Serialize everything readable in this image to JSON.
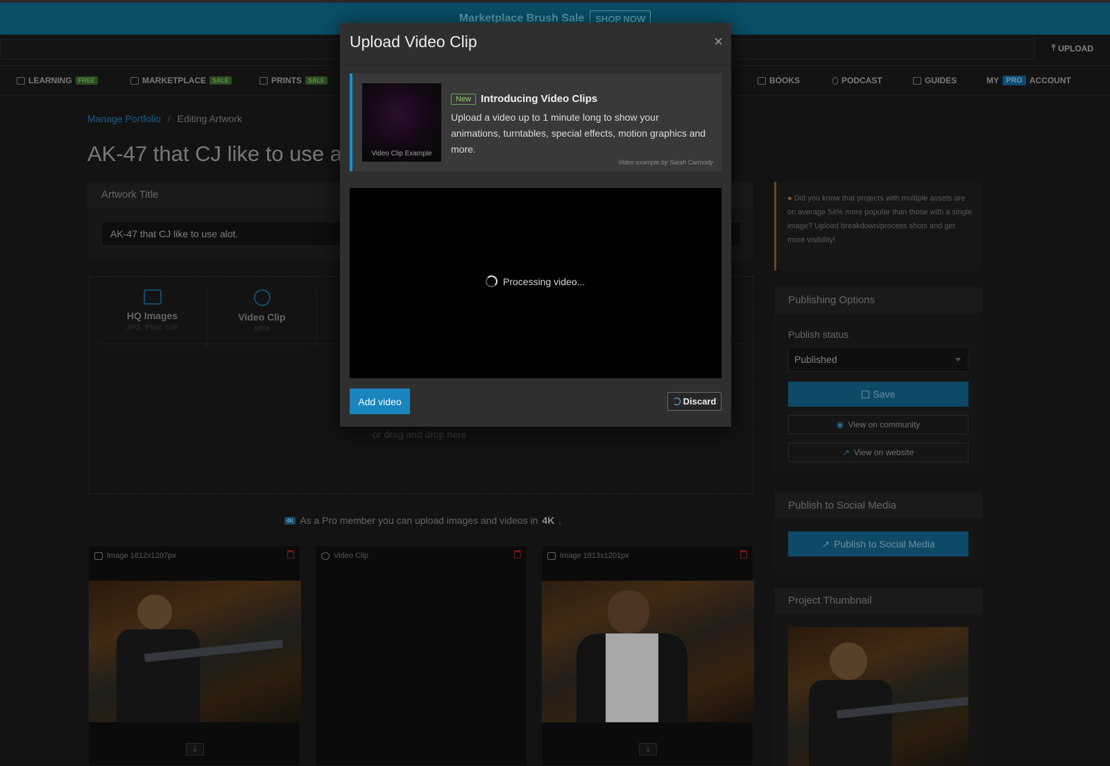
{
  "banner": {
    "text": "Marketplace Brush Sale",
    "cta": "SHOP NOW"
  },
  "header": {
    "upload_label": "UPLOAD"
  },
  "nav": {
    "learning": "LEARNING",
    "learning_tag": "FREE",
    "marketplace": "MARKETPLACE",
    "marketplace_tag": "SALE",
    "prints": "PRINTS",
    "prints_tag": "SALE",
    "books": "BOOKS",
    "podcast": "PODCAST",
    "guides": "GUIDES",
    "account_my": "MY",
    "account_pro": "PRO",
    "account_label": "ACCOUNT"
  },
  "breadcrumb": {
    "parent": "Manage Portfolio",
    "separator": "/",
    "current": "Editing Artwork"
  },
  "page": {
    "title": "AK-47 that CJ like to use alot."
  },
  "artwork_title": {
    "heading": "Artwork Title",
    "value": "AK-47 that CJ like to use alot."
  },
  "upload_types": [
    {
      "label": "HQ Images",
      "sub": "JPG, PNG, GIF"
    },
    {
      "label": "Video Clip",
      "sub": "MP4"
    }
  ],
  "dropzone": {
    "drag_text": "or drag and drop here"
  },
  "pro_note": {
    "badge": "4K",
    "text": "As a Pro member you can upload images and videos in",
    "emph": "4K",
    "end": "."
  },
  "assets": [
    {
      "label": "Image 1812x1207px"
    },
    {
      "label": "Video Clip"
    },
    {
      "label": "Image 1813x1201px"
    }
  ],
  "sidebar": {
    "tip": "Did you know that projects with multiple assets are on average 54% more popular than those with a single image? Upload breakdown/process shots and get more visibility!",
    "publishing_heading": "Publishing Options",
    "publish_status_label": "Publish status",
    "publish_status_value": "Published",
    "save_label": "Save",
    "view_community": "View on community",
    "view_website": "View on website",
    "social_heading": "Publish to Social Media",
    "social_button": "Publish to Social Media",
    "thumbnail_heading": "Project Thumbnail"
  },
  "modal": {
    "title": "Upload Video Clip",
    "close": "×",
    "thumb_caption": "Video Clip Example",
    "new_badge": "New",
    "intro_title": "Introducing Video Clips",
    "intro_text": "Upload a video up to 1 minute long to show your animations, turntables, special effects, motion graphics and more.",
    "credit": "Video example by Sarah Carmody",
    "processing": "Processing video...",
    "add_button": "Add video",
    "discard_button": "Discard"
  },
  "colors": {
    "accent": "#1985bf",
    "banner": "#0d6e90",
    "new_badge": "#6aa84f",
    "delete": "#9a2525"
  }
}
